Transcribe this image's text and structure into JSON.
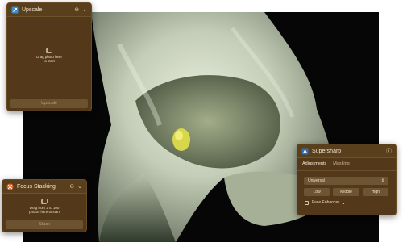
{
  "upscale_panel": {
    "title": "Upscale",
    "drop_line1": "Drag photo here",
    "drop_line2": "to start",
    "button_label": "Upscale",
    "icons": [
      "upscale-app-icon",
      "more-icon",
      "chevron-down-icon",
      "photos-icon"
    ]
  },
  "focus_panel": {
    "title": "Focus Stacking",
    "drop_line1": "Drag from 2 to 100",
    "drop_line2": "photos here to start",
    "button_label": "Stack",
    "icons": [
      "focus-stacking-app-icon",
      "more-icon",
      "chevron-down-icon",
      "photos-icon"
    ]
  },
  "supersharp_panel": {
    "title": "Supersharp",
    "tabs": [
      {
        "label": "Adjustments",
        "active": true
      },
      {
        "label": "Masking",
        "active": false
      }
    ],
    "mode_select": {
      "value": "Universal"
    },
    "strength_buttons": [
      "Low",
      "Middle",
      "High"
    ],
    "face_enhancer": {
      "label": "Face Enhancer",
      "checked": false
    },
    "icons": [
      "supersharp-app-icon",
      "info-icon",
      "dropdown-triangle-icon"
    ]
  },
  "colors": {
    "panel_bg": "#53391a",
    "panel_button": "#6b532f",
    "photo_bg": "#050605",
    "flower": "#d3dcc8"
  }
}
